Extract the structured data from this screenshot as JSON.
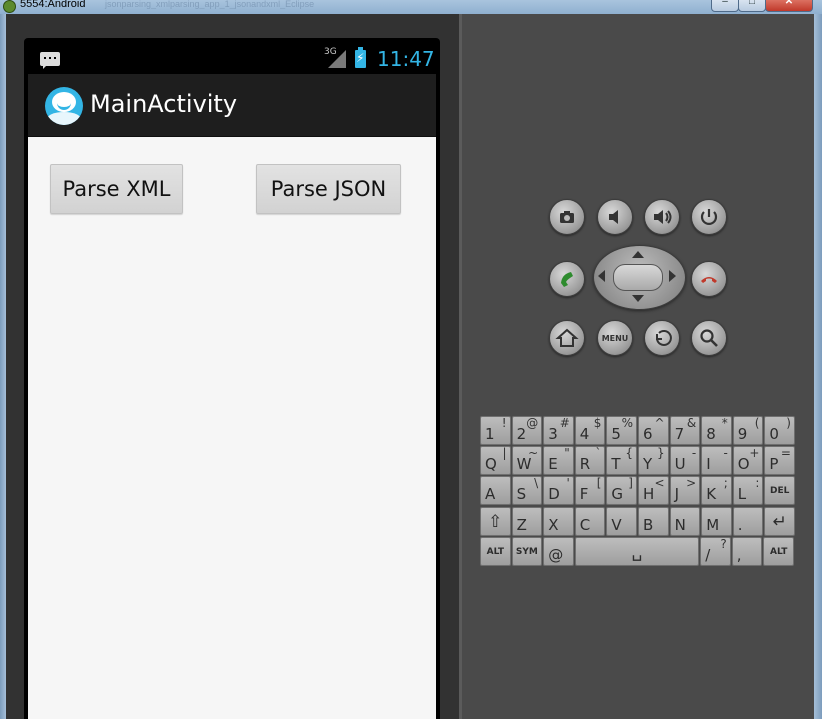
{
  "window": {
    "title": "5554:Android",
    "faint_text": "jsonparsing_xmlparsing_app_1_jsonandxml_Eclipse",
    "minimize_label": "–",
    "maximize_label": "□",
    "close_label": "✕"
  },
  "statusbar": {
    "network_type": "3G",
    "time": "11:47"
  },
  "actionbar": {
    "title": "MainActivity"
  },
  "buttons": {
    "parse_xml": "Parse XML",
    "parse_json": "Parse JSON"
  },
  "controls": {
    "icons": [
      "camera-icon",
      "volume-down-icon",
      "volume-up-icon",
      "power-icon",
      "call-icon",
      "end-call-icon",
      "home-icon",
      "menu-icon",
      "back-icon",
      "search-icon"
    ],
    "menu_label": "MENU",
    "call_color": "#2e8b2e",
    "end_call_color": "#c0392b"
  },
  "keyboard": {
    "row1": [
      {
        "main": "1",
        "alt": "!"
      },
      {
        "main": "2",
        "alt": "@"
      },
      {
        "main": "3",
        "alt": "#"
      },
      {
        "main": "4",
        "alt": "$"
      },
      {
        "main": "5",
        "alt": "%"
      },
      {
        "main": "6",
        "alt": "^"
      },
      {
        "main": "7",
        "alt": "&"
      },
      {
        "main": "8",
        "alt": "*"
      },
      {
        "main": "9",
        "alt": "("
      },
      {
        "main": "0",
        "alt": ")"
      }
    ],
    "row2": [
      {
        "main": "Q",
        "alt": "|"
      },
      {
        "main": "W",
        "alt": "~"
      },
      {
        "main": "E",
        "alt": "\""
      },
      {
        "main": "R",
        "alt": "`"
      },
      {
        "main": "T",
        "alt": "{"
      },
      {
        "main": "Y",
        "alt": "}"
      },
      {
        "main": "U",
        "alt": "-"
      },
      {
        "main": "I",
        "alt": "-"
      },
      {
        "main": "O",
        "alt": "+"
      },
      {
        "main": "P",
        "alt": "="
      }
    ],
    "row3": [
      {
        "main": "A",
        "alt": ""
      },
      {
        "main": "S",
        "alt": "\\"
      },
      {
        "main": "D",
        "alt": "'"
      },
      {
        "main": "F",
        "alt": "["
      },
      {
        "main": "G",
        "alt": "]"
      },
      {
        "main": "H",
        "alt": "<"
      },
      {
        "main": "J",
        "alt": ">"
      },
      {
        "main": "K",
        "alt": ";"
      },
      {
        "main": "L",
        "alt": ":"
      },
      {
        "main": "DEL",
        "alt": ""
      }
    ],
    "row4": [
      {
        "main": "⇧",
        "alt": ""
      },
      {
        "main": "Z",
        "alt": ""
      },
      {
        "main": "X",
        "alt": ""
      },
      {
        "main": "C",
        "alt": ""
      },
      {
        "main": "V",
        "alt": ""
      },
      {
        "main": "B",
        "alt": ""
      },
      {
        "main": "N",
        "alt": ""
      },
      {
        "main": "M",
        "alt": ""
      },
      {
        "main": ".",
        "alt": ""
      },
      {
        "main": "↵",
        "alt": ""
      }
    ],
    "row5": {
      "alt_left": "ALT",
      "sym": "SYM",
      "at": "@",
      "space": "␣",
      "slash": "/",
      "slash_alt": "?",
      "comma": ",",
      "alt_right": "ALT"
    }
  }
}
